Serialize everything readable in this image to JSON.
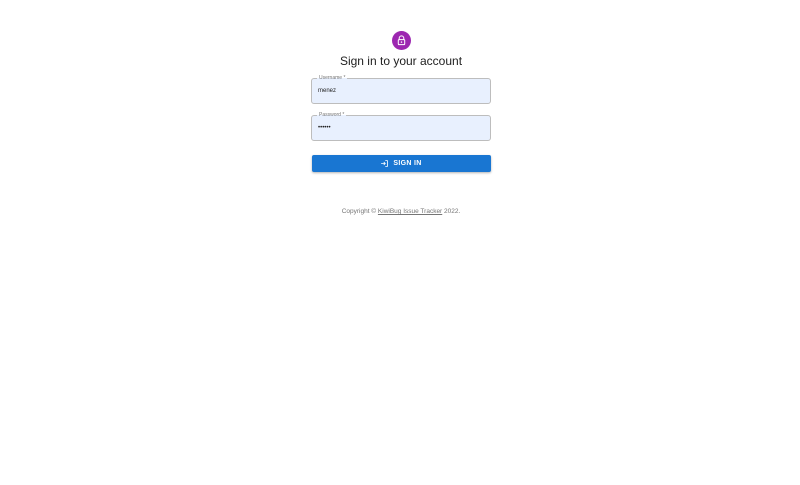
{
  "login": {
    "title": "Sign in to your account",
    "avatar_icon": "lock-icon",
    "avatar_color": "#9c27b0",
    "username": {
      "label": "Username *",
      "value": "menez"
    },
    "password": {
      "label": "Password *",
      "value": "••••••"
    },
    "signin_button": {
      "label": "SIGN IN",
      "icon": "login-icon",
      "color": "#1976d2"
    }
  },
  "footer": {
    "prefix": "Copyright © ",
    "link_text": "KiwiBug Issue Tracker",
    "suffix": " 2022."
  }
}
